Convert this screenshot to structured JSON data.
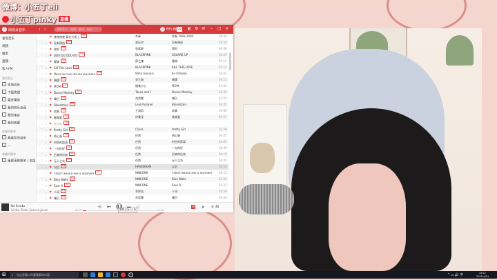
{
  "stream_overlay": {
    "line1": "微博：小五丁eii",
    "line2": "小五丁pinky",
    "badge": "直播"
  },
  "music_app": {
    "app_name": "网易云音乐",
    "search_placeholder": "搜索音乐，视频，歌词，电台",
    "username": "EEI.88",
    "vip_badge": "VIP",
    "sidebar": [
      {
        "label": "发现音乐",
        "type": "item"
      },
      {
        "label": "视频",
        "type": "item"
      },
      {
        "label": "朋友",
        "type": "item"
      },
      {
        "label": "直播",
        "type": "item"
      },
      {
        "label": "私人FM",
        "type": "item"
      },
      {
        "label": "我的音乐",
        "type": "head"
      },
      {
        "label": "本地音乐",
        "type": "item",
        "icon": "local-music-icon"
      },
      {
        "label": "下载管理",
        "type": "item",
        "icon": "download-icon"
      },
      {
        "label": "最近播放",
        "type": "item",
        "icon": "recent-icon"
      },
      {
        "label": "我的音乐云盘",
        "type": "item",
        "icon": "cloud-icon"
      },
      {
        "label": "我的电台",
        "type": "item",
        "icon": "radio-icon"
      },
      {
        "label": "我的收藏",
        "type": "item",
        "icon": "collection-icon"
      },
      {
        "label": "创建的歌单",
        "type": "head"
      },
      {
        "label": "我喜欢的音乐",
        "type": "item",
        "icon": "heart-icon"
      },
      {
        "label": "—",
        "type": "item",
        "icon": "playlist-icon"
      },
      {
        "label": "收藏的歌单",
        "type": "head"
      },
      {
        "label": "重建无聊歌单 | 白兔",
        "type": "item",
        "icon": "playlist-icon"
      }
    ],
    "tracks": [
      {
        "title": "夜夜夜夜 爱在大街上",
        "tag": "SQ",
        "artist": "齐秦",
        "album": "齐秦 1981-2000",
        "duration": "04:36"
      },
      {
        "title": "没有理由",
        "tag": "SQ",
        "artist": "游乐宗",
        "album": "没有理由",
        "duration": "03:50"
      },
      {
        "title": "我怕",
        "tag": "SQ",
        "artist": "张紫豪",
        "album": "我怕",
        "duration": "04:06"
      },
      {
        "title": "DDU-DU DDU-DU",
        "tag": "SQ",
        "artist": "BLACKPINK",
        "album": "SQUARE UP",
        "duration": "03:29"
      },
      {
        "title": "暧昧",
        "tag": "SQ",
        "artist": "薛之谦",
        "album": "暧昧",
        "duration": "05:12"
      },
      {
        "title": "Kill This Love",
        "tag": "SQ",
        "artist": "BLACKPINK",
        "album": "KILL THIS LOVE",
        "duration": "03:13"
      },
      {
        "title": "Dans les rues de ma jeunesse",
        "tag": "SQ",
        "artist": "Rémi Gervasi",
        "album": "En Ombres",
        "duration": "03:02"
      },
      {
        "title": "偶遇",
        "tag": "SQ",
        "artist": "李玉刚",
        "album": "偶遇",
        "duration": "04:21"
      },
      {
        "title": "MOM",
        "tag": "SQ",
        "artist": "蜡笔小心",
        "album": "MOM",
        "duration": "03:41"
      },
      {
        "title": "Dance Monkey",
        "tag": "SQ",
        "artist": "Tones and I",
        "album": "Dance Monkey",
        "duration": "03:29"
      },
      {
        "title": "嘴巴",
        "tag": "SQ",
        "artist": "刘昊霖",
        "album": "嘴巴",
        "duration": "03:20"
      },
      {
        "title": "Bloodstain",
        "tag": "SQ",
        "artist": "Lexi Parlaner",
        "album": "Bloodstain",
        "duration": "03:35"
      },
      {
        "title": "寂寞",
        "tag": "SQ",
        "artist": "王涵君",
        "album": "寂寞",
        "duration": "04:08"
      },
      {
        "title": "偷偷爱",
        "tag": "SQ",
        "artist": "徐秉龙",
        "album": "偷偷爱",
        "duration": "03:51"
      },
      {
        "title": "失去的",
        "tag": "SQ",
        "artist": "",
        "album": "",
        "duration": "",
        "grey": true
      },
      {
        "title": "Pretty Girl",
        "tag": "SQ",
        "artist": "Clairo",
        "album": "Pretty Girl",
        "duration": "02:58"
      },
      {
        "title": "热心肠",
        "tag": "SQ",
        "artist": "任然",
        "album": "热心肠",
        "duration": "04:47"
      },
      {
        "title": "时空的距离",
        "tag": "SQ",
        "artist": "任然",
        "album": "时空的距离",
        "duration": "04:03"
      },
      {
        "title": "一句你好",
        "tag": "SQ",
        "artist": "任然",
        "album": "一句你好",
        "duration": "03:39"
      },
      {
        "title": "后来的后来",
        "tag": "SQ",
        "artist": "任然",
        "album": "后来的后来",
        "duration": "04:19"
      },
      {
        "title": "无人之岛",
        "tag": "SQ",
        "artist": "任然",
        "album": "无人之岛",
        "duration": "04:45"
      },
      {
        "title": "以后",
        "tag": "SQ",
        "artist": "HANGEHAN",
        "album": "以后",
        "duration": "03:14"
      },
      {
        "title": "I don't wanna see u anymore",
        "tag": "SQ",
        "artist": "NINEONE",
        "album": "I don't wanna see u anymore",
        "duration": "03:15"
      },
      {
        "title": "Blue Walls",
        "tag": "SQ",
        "artist": "NINEONE",
        "album": "Blue Walls",
        "duration": "02:50"
      },
      {
        "title": "Sour H",
        "tag": "SQ",
        "artist": "NINEONE",
        "album": "Sour H",
        "duration": "03:33"
      },
      {
        "title": "人间",
        "tag": "SQ",
        "artist": "李荣浩",
        "album": "人间",
        "duration": "03:59"
      },
      {
        "title": "嘴巴",
        "tag": "SQ",
        "artist": "刘昊霖",
        "album": "嘴巴",
        "duration": "03:20"
      }
    ],
    "player": {
      "song": "No Scrubs",
      "artist": "Unlike Pluto / Joanna Jones",
      "elapsed": "00:00",
      "total": "03:39",
      "progress": 0.05,
      "tooltip": "暂停 (Ctrl + P)",
      "lyrics_btn": "词",
      "playlist_count": "48"
    }
  },
  "taskbar": {
    "search_placeholder": "在这里输入你要搜索的内容",
    "time": "14:12",
    "date": "2021/4/14",
    "tray": "^ ⌂ 🔊 中"
  }
}
